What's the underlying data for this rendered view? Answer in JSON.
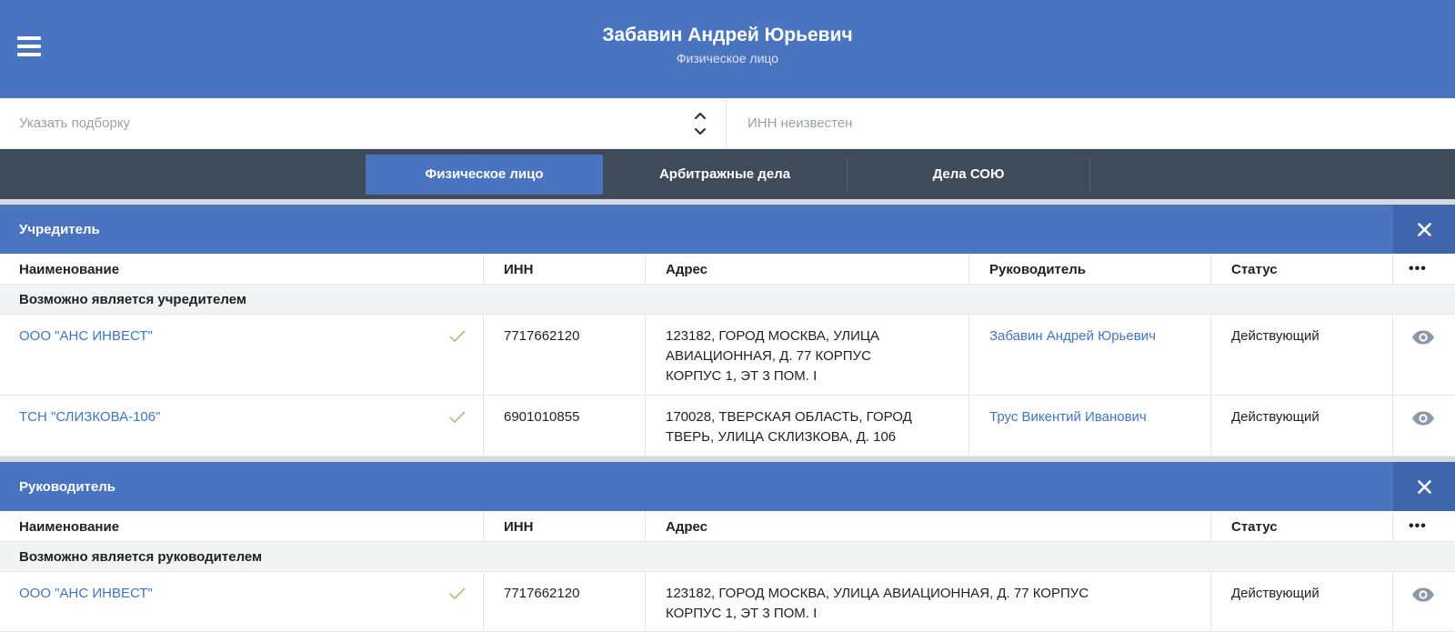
{
  "header": {
    "title": "Забавин Андрей Юрьевич",
    "subtitle": "Физическое лицо",
    "menu_icon": "hamburger-icon"
  },
  "filter": {
    "select_placeholder": "Указать подборку",
    "inn_text": "ИНН неизвестен"
  },
  "tabs": [
    {
      "label": "Физическое лицо",
      "active": true
    },
    {
      "label": "Арбитражные дела",
      "active": false
    },
    {
      "label": "Дела СОЮ",
      "active": false
    }
  ],
  "columns": {
    "name": "Наименование",
    "inn": "ИНН",
    "address": "Адрес",
    "director": "Руководитель",
    "status": "Статус",
    "more": "•••"
  },
  "founder": {
    "title": "Учредитель",
    "group": "Возможно является учредителем",
    "rows": [
      {
        "name": "ООО \"АНС ИНВЕСТ\"",
        "inn": "7717662120",
        "address": [
          "123182, ГОРОД МОСКВА, УЛИЦА",
          "АВИАЦИОННАЯ, Д. 77 КОРПУС",
          "КОРПУС 1, ЭТ 3 ПОМ. I"
        ],
        "director": "Забавин Андрей Юрьевич",
        "status": "Действующий"
      },
      {
        "name": "ТСН \"СЛИЗКОВА-106\"",
        "inn": "6901010855",
        "address": [
          "170028, ТВЕРСКАЯ ОБЛАСТЬ, ГОРОД",
          "ТВЕРЬ, УЛИЦА СКЛИЗКОВА, Д. 106"
        ],
        "director": "Трус Викентий Иванович",
        "status": "Действующий"
      }
    ]
  },
  "manager": {
    "title": "Руководитель",
    "group": "Возможно является руководителем",
    "rows": [
      {
        "name": "ООО \"АНС ИНВЕСТ\"",
        "inn": "7717662120",
        "address": [
          "123182, ГОРОД МОСКВА, УЛИЦА АВИАЦИОННАЯ, Д. 77 КОРПУС",
          "КОРПУС 1, ЭТ 3 ПОМ. I"
        ],
        "status": "Действующий"
      }
    ]
  },
  "colors": {
    "primary": "#4a74bf",
    "tabbar": "#3f4a5b",
    "link": "#3f74c4",
    "check": "#a8c97a",
    "eye": "#8d98a8"
  }
}
